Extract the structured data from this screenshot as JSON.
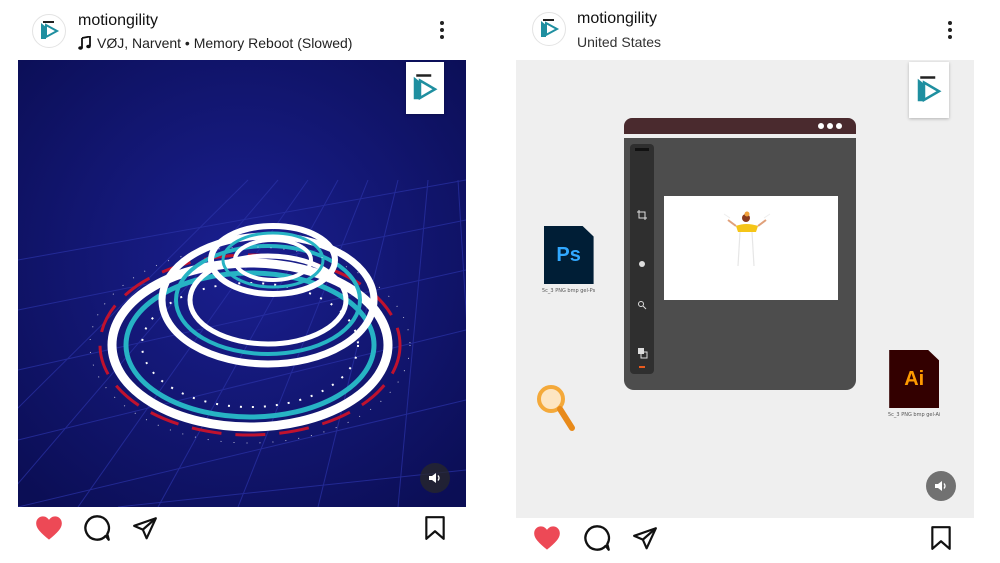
{
  "posts": [
    {
      "username": "motiongility",
      "subline": "VØJ, Narvent • Memory Reboot (Slowed)",
      "liked": true
    },
    {
      "username": "motiongility",
      "subline": "United States",
      "liked": true,
      "media": {
        "ps_label": "Ps",
        "ps_caption": "5c_3 PNG bmp gel-Ps",
        "ai_label": "Ai",
        "ai_caption": "5c_3 PNG bmp gel-Ai"
      }
    }
  ],
  "colors": {
    "like": "#ed4956",
    "left_bg": "#0d1165",
    "ring_cyan": "#27b3c4",
    "ps_bg": "#001e36",
    "ps_fg": "#31a8ff",
    "ai_bg": "#330000",
    "ai_fg": "#ff9a00"
  },
  "icons": [
    "music-note-icon",
    "more-options-icon",
    "speaker-icon",
    "heart-icon",
    "comment-icon",
    "share-icon",
    "bookmark-icon",
    "brand-logo-icon",
    "magnifier-icon"
  ]
}
